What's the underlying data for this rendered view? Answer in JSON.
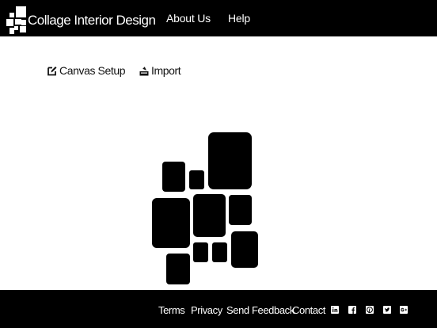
{
  "header": {
    "app_title": "Collage Interior Design",
    "nav": [
      {
        "label": "About Us"
      },
      {
        "label": "Help"
      }
    ]
  },
  "toolbar": {
    "canvas_setup_label": "Canvas Setup",
    "import_label": "Import"
  },
  "footer": {
    "links": [
      {
        "label": "Terms"
      },
      {
        "label": "Privacy"
      },
      {
        "label": "Send Feedback"
      },
      {
        "label": "Contact"
      }
    ],
    "social_icons": [
      "linkedin-icon",
      "facebook-icon",
      "pinterest-icon",
      "twitter-icon",
      "google-plus-icon"
    ]
  },
  "colors": {
    "bar_background": "#000000",
    "page_background": "#ffffff",
    "tile": "#000000"
  }
}
